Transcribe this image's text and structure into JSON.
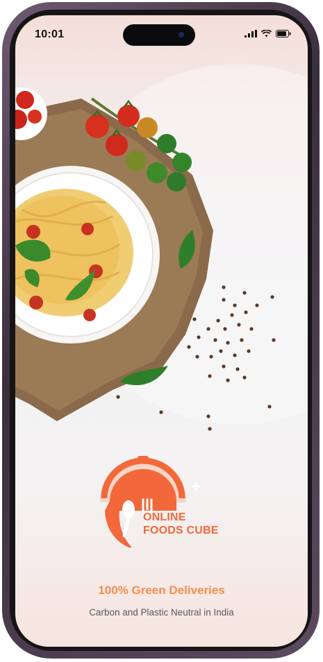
{
  "status_bar": {
    "time": "10:01"
  },
  "brand": {
    "line1": "ONLINE",
    "line2": "FOODS CUBE"
  },
  "tagline": "100% Green Deliveries",
  "subtitle": "Carbon and Plastic Neutral in India",
  "colors": {
    "brand_orange": "#f2683a",
    "tagline_orange": "#f58d4e",
    "subtitle_gray": "#5a5a5a"
  },
  "icons": [
    "signal-icon",
    "wifi-icon",
    "battery-icon"
  ]
}
